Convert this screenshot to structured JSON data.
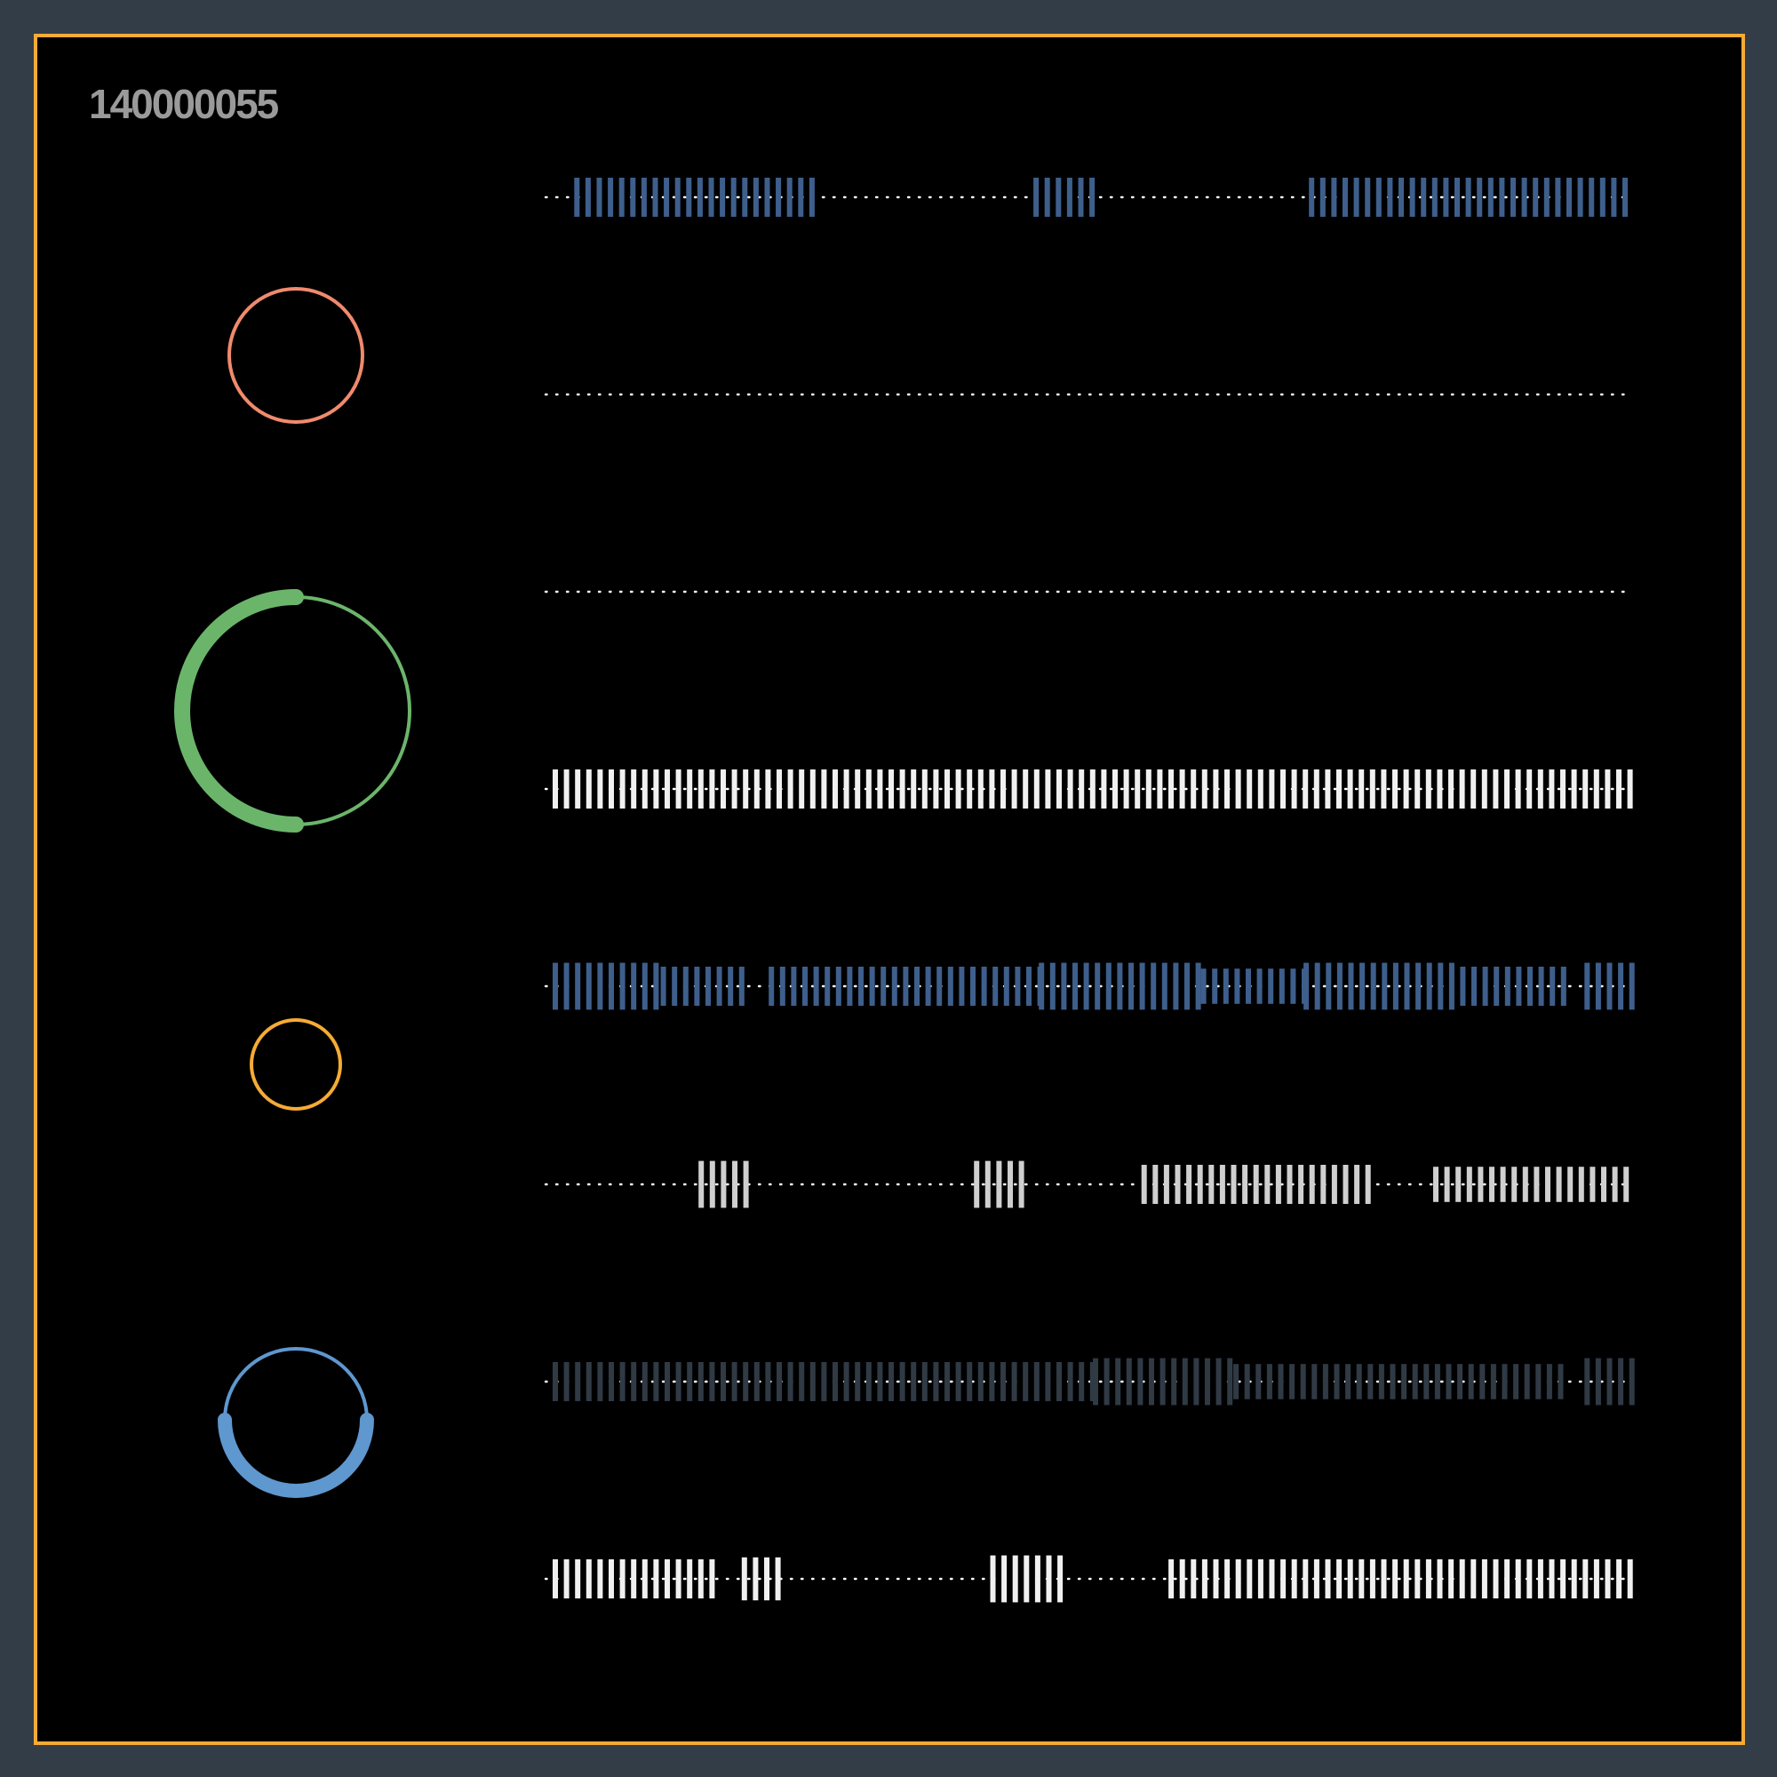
{
  "title": "140000055",
  "colors": {
    "background": "#333d48",
    "panel": "#000000",
    "frame": "#f5ab35",
    "title": "#9a9a9a",
    "dots": "#ffffff",
    "bar_blue": "#3e5f8c",
    "bar_white": "#f0f0f0",
    "bar_grey": "#cfcfcf",
    "bar_dark": "#303a45"
  },
  "rings": [
    {
      "name": "salmon-ring",
      "color": "#f08a6e",
      "arc_fraction": 0.0
    },
    {
      "name": "green-ring",
      "color": "#6bb56b",
      "arc_fraction": 0.5
    },
    {
      "name": "yellow-ring",
      "color": "#f5ab35",
      "arc_fraction": 0.0
    },
    {
      "name": "blue-ring",
      "color": "#5f97cf",
      "arc_fraction": 0.5
    }
  ],
  "tracks": [
    {
      "name": "track-1",
      "color": "bar_blue",
      "segments": [
        [
          0.02,
          0.245,
          1.0
        ],
        [
          0.445,
          0.5,
          1.0
        ],
        [
          0.7,
          1.0,
          1.0
        ]
      ]
    },
    {
      "name": "track-2",
      "color": "bar_white",
      "segments": []
    },
    {
      "name": "track-3",
      "color": "bar_white",
      "segments": []
    },
    {
      "name": "track-4",
      "color": "bar_white",
      "segments": [
        [
          0.0,
          1.0,
          1.0
        ]
      ]
    },
    {
      "name": "track-5",
      "color": "bar_blue",
      "segments": [
        [
          0.0,
          0.1,
          1.2
        ],
        [
          0.1,
          0.18,
          1.0
        ],
        [
          0.2,
          0.45,
          1.0
        ],
        [
          0.45,
          0.6,
          1.2
        ],
        [
          0.6,
          0.695,
          0.9
        ],
        [
          0.695,
          0.84,
          1.2
        ],
        [
          0.84,
          0.935,
          1.0
        ],
        [
          0.955,
          1.0,
          1.2
        ]
      ]
    },
    {
      "name": "track-6",
      "color": "bar_grey",
      "segments": [
        [
          0.135,
          0.18,
          1.2
        ],
        [
          0.39,
          0.435,
          1.2
        ],
        [
          0.545,
          0.755,
          1.0
        ],
        [
          0.815,
          1.0,
          0.9
        ]
      ]
    },
    {
      "name": "track-7",
      "color": "bar_dark",
      "segments": [
        [
          0.0,
          0.5,
          1.0
        ],
        [
          0.5,
          0.63,
          1.2
        ],
        [
          0.63,
          0.935,
          0.9
        ],
        [
          0.955,
          1.0,
          1.2
        ]
      ]
    },
    {
      "name": "track-8",
      "color": "bar_white",
      "segments": [
        [
          0.0,
          0.15,
          1.0
        ],
        [
          0.175,
          0.215,
          1.1
        ],
        [
          0.405,
          0.475,
          1.2
        ],
        [
          0.57,
          1.0,
          1.0
        ]
      ]
    }
  ]
}
